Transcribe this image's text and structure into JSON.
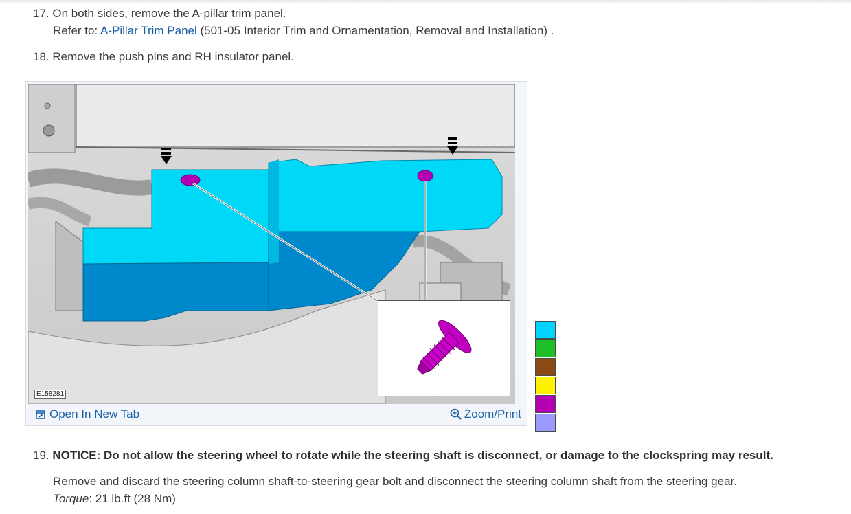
{
  "steps": {
    "s17": {
      "number": "17.",
      "text": "On both sides, remove the A-pillar trim panel.",
      "refer_prefix": "Refer to:",
      "refer_link": "A-Pillar Trim Panel",
      "refer_suffix": "(501-05 Interior Trim and Ornamentation, Removal and Installation) ."
    },
    "s18": {
      "number": "18.",
      "text": "Remove the push pins and RH insulator panel."
    },
    "s19": {
      "number": "19.",
      "notice": "NOTICE: Do not allow the steering wheel to rotate while the steering shaft is disconnect, or damage to the clockspring may result.",
      "body": "Remove and discard the steering column shaft-to-steering gear bolt and disconnect the steering column shaft from the steering gear.",
      "torque_label": "Torque",
      "torque_value": ": 21 lb.ft (28 Nm)"
    }
  },
  "figure": {
    "id_label": "E158281",
    "open_tab_label": "Open In New Tab",
    "zoom_label": "Zoom/Print"
  },
  "legend": {
    "colors": [
      "#00d4ff",
      "#1fbf2a",
      "#8b4a14",
      "#fff200",
      "#b400b4",
      "#9a9aff"
    ]
  }
}
